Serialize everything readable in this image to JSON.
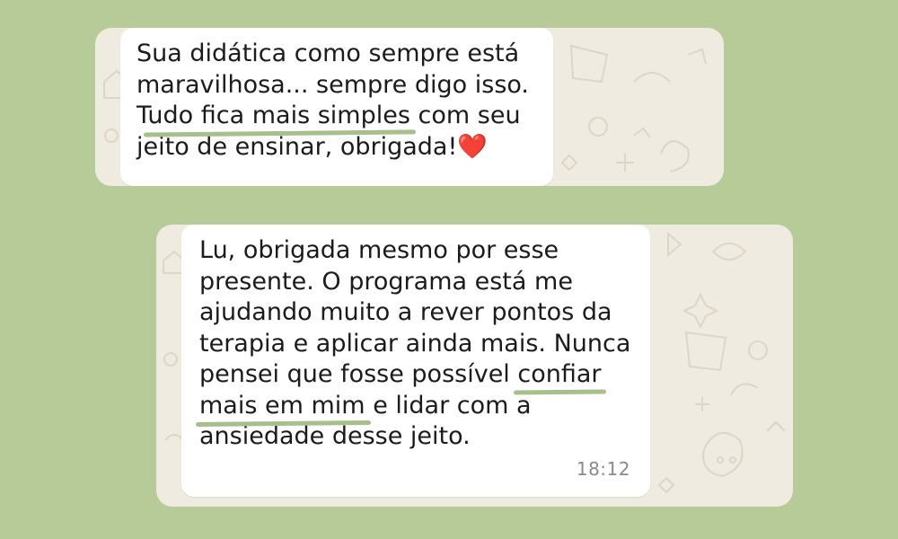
{
  "background_color": "#b6cb98",
  "messages": [
    {
      "lines": [
        {
          "a": "Sua didática como sempre está"
        },
        {
          "a": "maravilhosa... sempre digo isso."
        },
        {
          "a": "T",
          "hl": "udo fica mais simples",
          "b": " com seu"
        },
        {
          "a": "jeito de ensinar, obrigada!",
          "heart": "❤️"
        }
      ],
      "time": ""
    },
    {
      "lines": [
        {
          "a": "Lu, obrigada mesmo por esse"
        },
        {
          "a": "presente. O programa está me"
        },
        {
          "a": "ajudando muito a rever pontos da"
        },
        {
          "a": "terapia e aplicar ainda mais. Nunca"
        },
        {
          "a": "pensei que fosse possível ",
          "hl": "confiar"
        },
        {
          "hl": "mais em mim",
          "b": " e lidar com a"
        },
        {
          "a": "ansiedade desse jeito."
        }
      ],
      "time": "18:12"
    }
  ]
}
